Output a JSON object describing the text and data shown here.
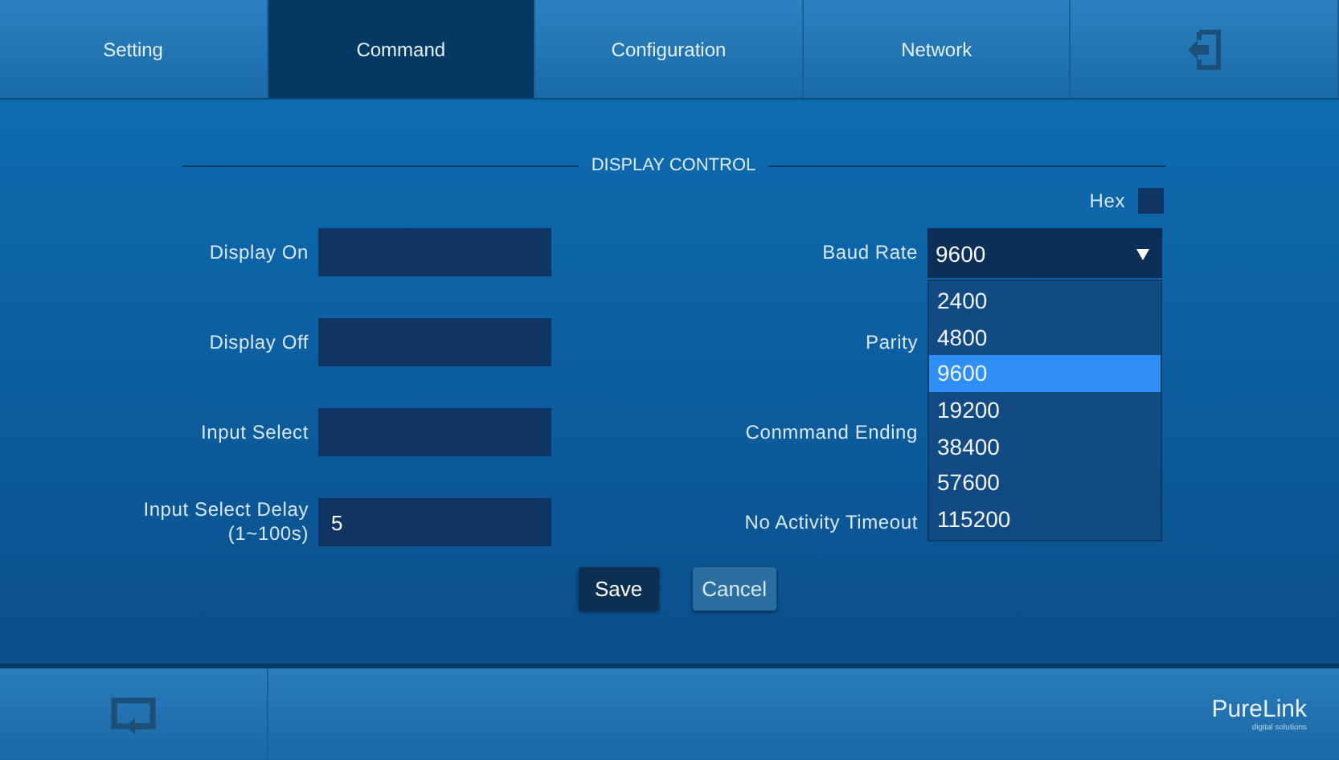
{
  "tabs": [
    {
      "label": "Setting",
      "selected": false
    },
    {
      "label": "Command",
      "selected": true
    },
    {
      "label": "Configuration",
      "selected": false
    },
    {
      "label": "Network",
      "selected": false
    }
  ],
  "section_title": "DISPLAY CONTROL",
  "hex": {
    "label": "Hex",
    "checked": false
  },
  "left_fields": [
    {
      "label": "Display On"
    },
    {
      "label": "Display Off"
    },
    {
      "label": "Input Select"
    },
    {
      "label": "Input Select Delay\n(1~100s)",
      "value": "5"
    }
  ],
  "right_fields": [
    {
      "label": "Baud Rate",
      "kind": "select",
      "value": "9600",
      "expanded": true,
      "options": [
        {
          "label": "2400",
          "selected": false
        },
        {
          "label": "4800",
          "selected": false
        },
        {
          "label": "9600",
          "selected": true
        },
        {
          "label": "19200",
          "selected": false
        },
        {
          "label": "38400",
          "selected": false
        },
        {
          "label": "57600",
          "selected": false
        },
        {
          "label": "115200",
          "selected": false
        }
      ]
    },
    {
      "label": "Parity",
      "kind": "select"
    },
    {
      "label": "Conmmand Ending",
      "kind": "select"
    },
    {
      "label": "No Activity Timeout",
      "kind": "select"
    }
  ],
  "buttons": [
    "Save",
    "Cancel"
  ],
  "brand": {
    "name": "PureLink",
    "tagline": "digital solutions"
  }
}
